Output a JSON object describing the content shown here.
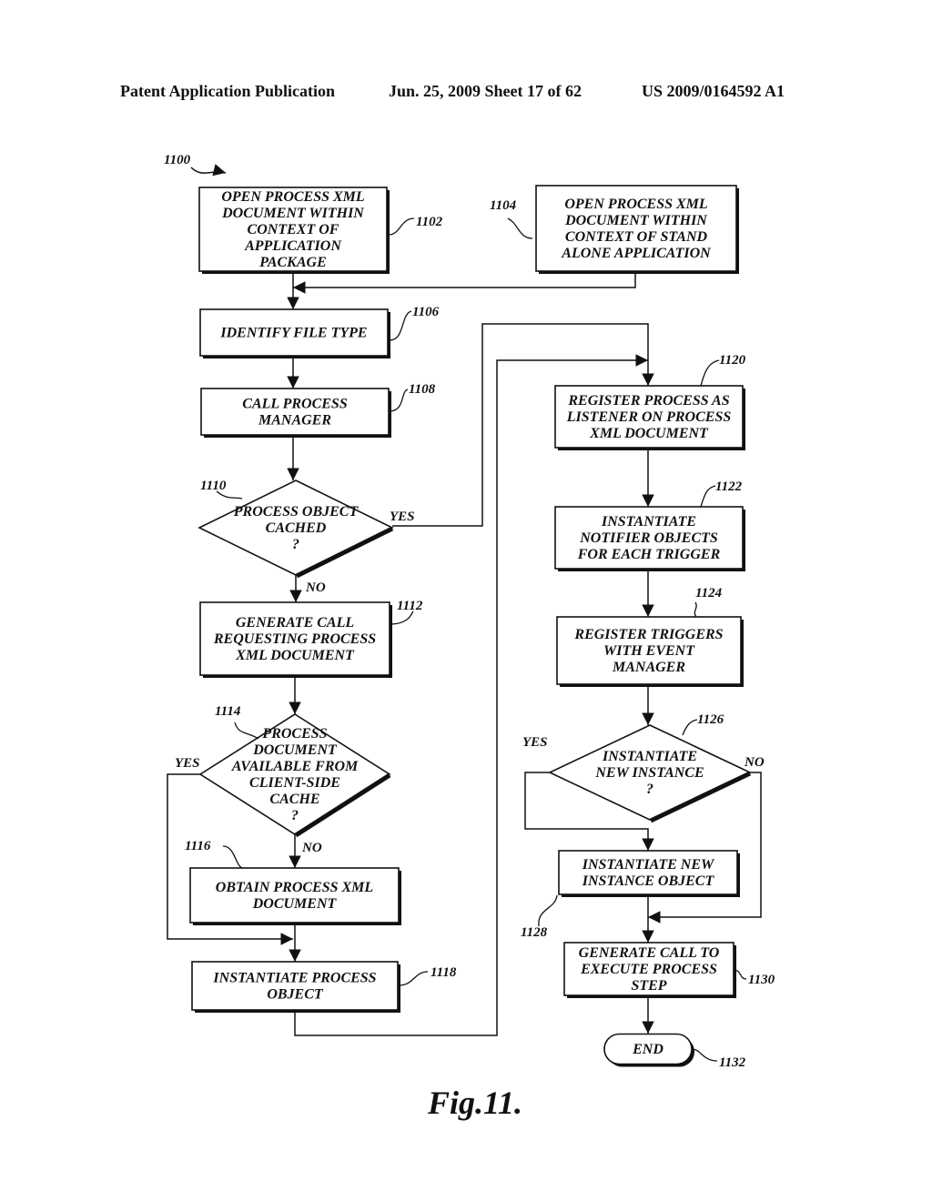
{
  "header": {
    "left": "Patent Application Publication",
    "middle": "Jun. 25, 2009  Sheet 17 of 62",
    "right": "US 2009/0164592 A1"
  },
  "figure": {
    "ref": "1100",
    "caption": "Fig.11."
  },
  "nodes": {
    "n1102": {
      "ref": "1102",
      "type": "process",
      "lines": [
        "OPEN PROCESS XML",
        "DOCUMENT WITHIN",
        "CONTEXT OF",
        "APPLICATION",
        "PACKAGE"
      ]
    },
    "n1104": {
      "ref": "1104",
      "type": "process",
      "lines": [
        "OPEN PROCESS XML",
        "DOCUMENT WITHIN",
        "CONTEXT OF STAND",
        "ALONE APPLICATION"
      ]
    },
    "n1106": {
      "ref": "1106",
      "type": "process",
      "lines": [
        "IDENTIFY FILE TYPE"
      ]
    },
    "n1108": {
      "ref": "1108",
      "type": "process",
      "lines": [
        "CALL PROCESS",
        "MANAGER"
      ]
    },
    "n1110": {
      "ref": "1110",
      "type": "decision",
      "lines": [
        "PROCESS OBJECT",
        "CACHED",
        "?"
      ],
      "yes": "YES",
      "no": "NO"
    },
    "n1112": {
      "ref": "1112",
      "type": "process",
      "lines": [
        "GENERATE CALL",
        "REQUESTING PROCESS",
        "XML DOCUMENT"
      ]
    },
    "n1114": {
      "ref": "1114",
      "type": "decision",
      "lines": [
        "PROCESS",
        "DOCUMENT",
        "AVAILABLE FROM",
        "CLIENT-SIDE",
        "CACHE",
        "?"
      ],
      "yes": "YES",
      "no": "NO"
    },
    "n1116": {
      "ref": "1116",
      "type": "process",
      "lines": [
        "OBTAIN PROCESS XML",
        "DOCUMENT"
      ]
    },
    "n1118": {
      "ref": "1118",
      "type": "process",
      "lines": [
        "INSTANTIATE PROCESS",
        "OBJECT"
      ]
    },
    "n1120": {
      "ref": "1120",
      "type": "process",
      "lines": [
        "REGISTER PROCESS AS",
        "LISTENER ON PROCESS",
        "XML DOCUMENT"
      ]
    },
    "n1122": {
      "ref": "1122",
      "type": "process",
      "lines": [
        "INSTANTIATE",
        "NOTIFIER OBJECTS",
        "FOR EACH TRIGGER"
      ]
    },
    "n1124": {
      "ref": "1124",
      "type": "process",
      "lines": [
        "REGISTER TRIGGERS",
        "WITH EVENT",
        "MANAGER"
      ]
    },
    "n1126": {
      "ref": "1126",
      "type": "decision",
      "lines": [
        "INSTANTIATE",
        "NEW INSTANCE",
        "?"
      ],
      "yes": "YES",
      "no": "NO"
    },
    "n1128": {
      "ref": "1128",
      "type": "process",
      "lines": [
        "INSTANTIATE NEW",
        "INSTANCE OBJECT"
      ]
    },
    "n1130": {
      "ref": "1130",
      "type": "process",
      "lines": [
        "GENERATE CALL TO",
        "EXECUTE PROCESS",
        "STEP"
      ]
    },
    "n1132": {
      "ref": "1132",
      "type": "terminal",
      "lines": [
        "END"
      ]
    }
  }
}
